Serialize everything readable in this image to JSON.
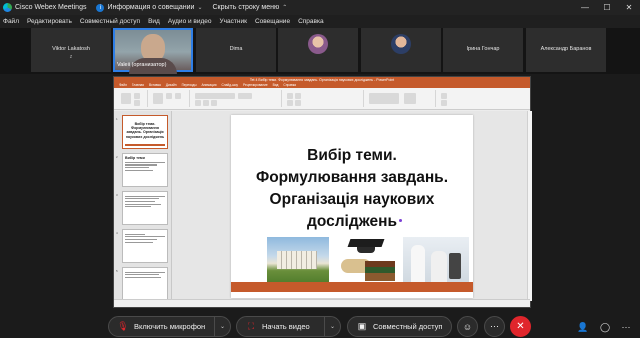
{
  "app": {
    "title": "Cisco Webex Meetings",
    "meeting_info": "Информация о совещании",
    "hide_menu": "Скрыть строку меню"
  },
  "menu": [
    "Файл",
    "Редактировать",
    "Совместный доступ",
    "Вид",
    "Аудио и видео",
    "Участник",
    "Совещание",
    "Справка"
  ],
  "participants": [
    {
      "name": "Viktor Lakatosh",
      "sub": "z"
    },
    {
      "name": "Valeii",
      "sub": "(организатор)",
      "video": true
    },
    {
      "name": "Dima"
    },
    {
      "name": ""
    },
    {
      "name": ""
    },
    {
      "name": "Ірина Гончар"
    },
    {
      "name": "Александр Баранов"
    }
  ],
  "ppt": {
    "window_title": "Tet 4 Вибір теми. Формулювання завдань. Організація наукових досліджень - PowerPoint",
    "tabs": [
      "Файл",
      "Главная",
      "Вставка",
      "Дизайн",
      "Переходы",
      "Анимация",
      "Слайд-шоу",
      "Рецензирование",
      "Вид",
      "Справка"
    ],
    "thumbs": [
      {
        "num": "1",
        "title": "Вибір теми. Формулювання завдань. Організація наукових досліджень"
      },
      {
        "num": "2",
        "title": "Вибір теми"
      },
      {
        "num": "3",
        "title": ""
      },
      {
        "num": "4",
        "title": ""
      },
      {
        "num": "5",
        "title": ""
      }
    ],
    "slide_title": "Вибір теми. Формулювання завдань. Організація наукових досліджень"
  },
  "controls": {
    "mic": "Включить микрофон",
    "video": "Начать видео",
    "share": "Совместный доступ"
  },
  "colors": {
    "accent": "#c55a2b",
    "end_call": "#e0262c",
    "active_border": "#2e7ee6"
  }
}
